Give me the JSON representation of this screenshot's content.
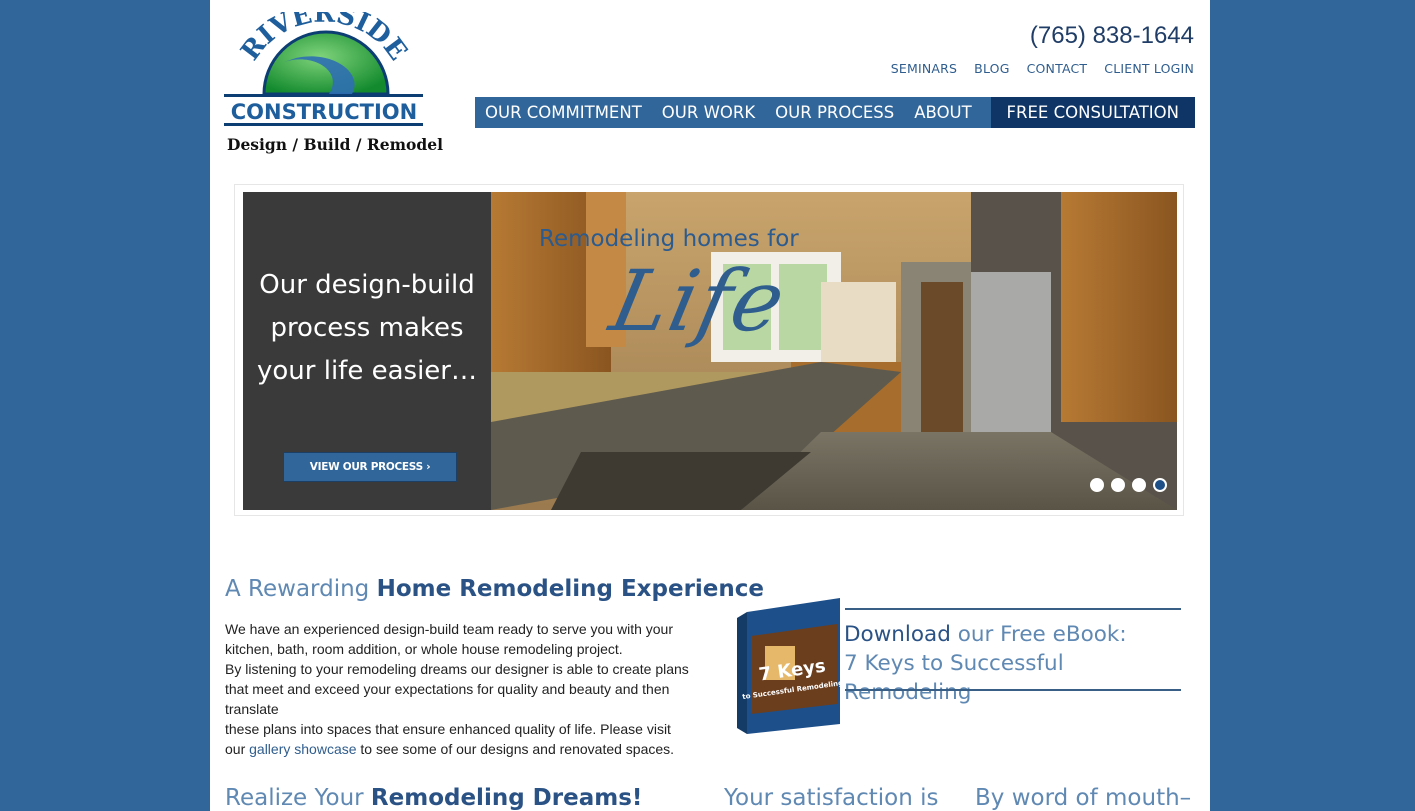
{
  "logo": {
    "arc_text": "RIVERSIDE",
    "name": "CONSTRUCTION",
    "tagline": "Design / Build / Remodel"
  },
  "header": {
    "phone": "(765) 838-1644",
    "utility_nav": [
      "SEMINARS",
      "BLOG",
      "CONTACT",
      "CLIENT LOGIN"
    ],
    "main_nav": [
      "OUR COMMITMENT",
      "OUR WORK",
      "OUR PROCESS",
      "ABOUT"
    ],
    "cta": "FREE CONSULTATION"
  },
  "slider": {
    "title": "Our design-build process makes your life easier…",
    "button": "VIEW OUR PROCESS  ›",
    "headline": "Remodeling homes for",
    "script": "Life",
    "dots": 4,
    "active_dot": 4
  },
  "intro": {
    "heading_light": "A Rewarding ",
    "heading_bold": "Home Remodeling Experience",
    "p1": "We have an experienced design-build team ready to serve you with your kitchen, bath, room addition, or whole house remodeling project.",
    "p2": "By listening to your remodeling dreams our designer is able to create plans that meet and exceed your expectations for quality and beauty and then translate",
    "p3_before": "these plans into spaces that ensure enhanced quality of life. Please visit our ",
    "p3_link": "gallery showcase",
    "p3_after": " to see some of our designs and renovated spaces."
  },
  "ebook": {
    "line1_bold": "Download",
    "line1_rest": " our Free eBook:",
    "line2": "7 Keys to Successful Remodeling",
    "cover_title": "7 Keys",
    "cover_sub": "to Successful Remodeling"
  },
  "bottom": {
    "dreams_light": "Realize Your ",
    "dreams_bold": "Remodeling Dreams!",
    "satisfaction": "Your satisfaction is",
    "word_of_mouth": "By word of mouth–"
  },
  "colors": {
    "background": "#31669b",
    "nav": "#31669b",
    "cta": "#0e3566",
    "heading_light": "#5f88b3",
    "heading_bold": "#2a5285"
  }
}
